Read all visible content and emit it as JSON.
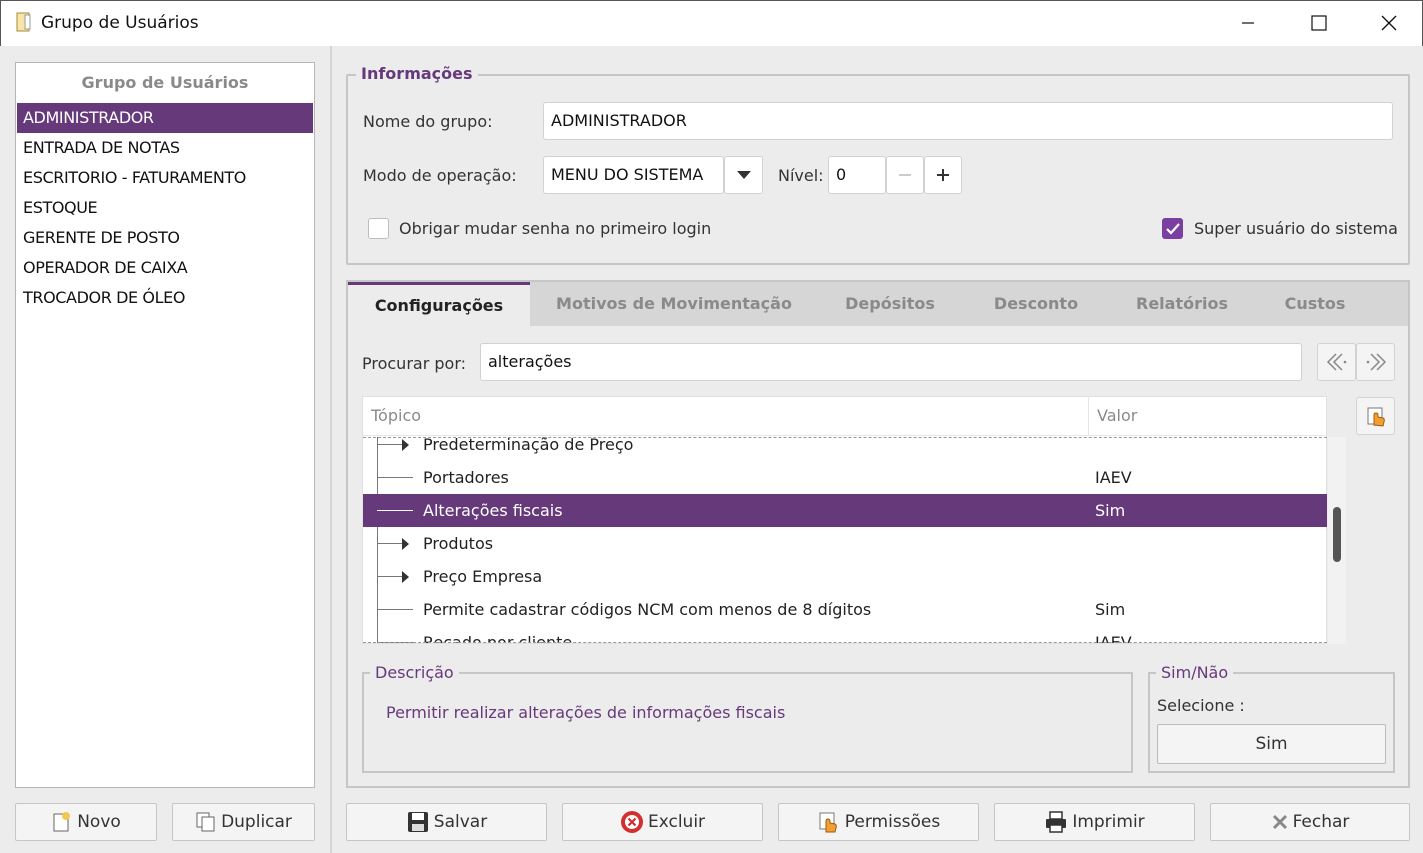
{
  "window": {
    "title": "Grupo de Usuários"
  },
  "groups": {
    "header": "Grupo de Usuários",
    "items": [
      "ADMINISTRADOR",
      "ENTRADA DE NOTAS",
      "ESCRITORIO - FATURAMENTO",
      "ESTOQUE",
      "GERENTE DE POSTO",
      "OPERADOR DE CAIXA",
      "TROCADOR DE ÓLEO"
    ],
    "selected": "ADMINISTRADOR"
  },
  "left_buttons": {
    "new": "Novo",
    "duplicate": "Duplicar"
  },
  "info": {
    "legend": "Informações",
    "group_name_label": "Nome do grupo:",
    "group_name_value": "ADMINISTRADOR",
    "mode_label": "Modo de operação:",
    "mode_value": "MENU DO SISTEMA",
    "level_label": "Nível:",
    "level_value": "0",
    "force_password_label": "Obrigar mudar senha no primeiro login",
    "force_password_checked": false,
    "superuser_label": "Super usuário do sistema",
    "superuser_checked": true
  },
  "tabs": [
    "Configurações",
    "Motivos de Movimentação",
    "Depósitos",
    "Desconto",
    "Relatórios",
    "Custos"
  ],
  "active_tab": "Configurações",
  "search": {
    "label": "Procurar por:",
    "value": "alterações"
  },
  "tree": {
    "col_topic": "Tópico",
    "col_value": "Valor",
    "rows": [
      {
        "topic": "Predeterminação de Preço",
        "value": "",
        "expandable": true
      },
      {
        "topic": "Portadores",
        "value": "IAEV",
        "expandable": false
      },
      {
        "topic": "Alterações fiscais",
        "value": "Sim",
        "expandable": false,
        "selected": true
      },
      {
        "topic": "Produtos",
        "value": "",
        "expandable": true
      },
      {
        "topic": "Preço Empresa",
        "value": "",
        "expandable": true
      },
      {
        "topic": "Permite cadastrar códigos NCM com menos de 8 dígitos",
        "value": "Sim",
        "expandable": false
      },
      {
        "topic": "Recado por cliente",
        "value": "IAEV",
        "expandable": false
      }
    ]
  },
  "description": {
    "legend": "Descrição",
    "text": "Permitir realizar alterações de informações fiscais"
  },
  "simnao": {
    "legend": "Sim/Não",
    "select_label": "Selecione :",
    "button": "Sim"
  },
  "bottom_buttons": {
    "save": "Salvar",
    "delete": "Excluir",
    "permissions": "Permissões",
    "print": "Imprimir",
    "close": "Fechar"
  },
  "colors": {
    "accent": "#66397a",
    "check": "#7a3fa0"
  }
}
